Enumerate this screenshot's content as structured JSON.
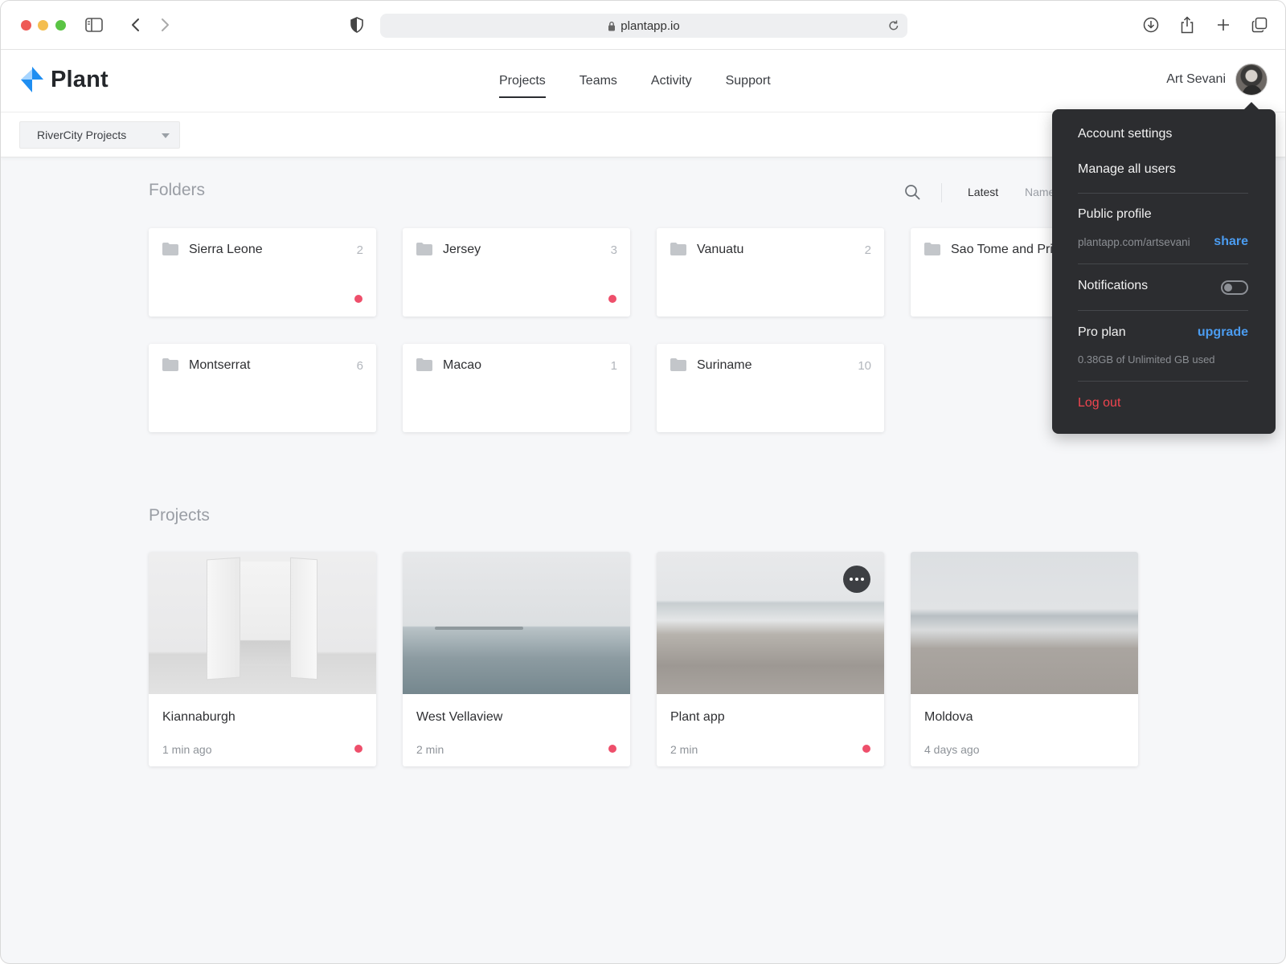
{
  "browser": {
    "url": "plantapp.io"
  },
  "app": {
    "logo_text": "Plant",
    "nav": [
      {
        "label": "Projects",
        "active": true
      },
      {
        "label": "Teams",
        "active": false
      },
      {
        "label": "Activity",
        "active": false
      },
      {
        "label": "Support",
        "active": false
      }
    ],
    "user_name": "Art Sevani",
    "team_selector": "RiverCity Projects"
  },
  "folders": {
    "title": "Folders",
    "sort": {
      "latest": "Latest",
      "name": "Name"
    },
    "items": [
      {
        "name": "Sierra Leone",
        "count": "2",
        "unread": true
      },
      {
        "name": "Jersey",
        "count": "3",
        "unread": true
      },
      {
        "name": "Vanuatu",
        "count": "2",
        "unread": false
      },
      {
        "name": "Sao Tome and Principe",
        "count": "",
        "unread": false
      },
      {
        "name": "Montserrat",
        "count": "6",
        "unread": false
      },
      {
        "name": "Macao",
        "count": "1",
        "unread": false
      },
      {
        "name": "Suriname",
        "count": "10",
        "unread": false
      }
    ]
  },
  "projects": {
    "title": "Projects",
    "items": [
      {
        "name": "Kiannaburgh",
        "time": "1 min ago",
        "unread": true,
        "thumb": "doors"
      },
      {
        "name": "West Vellaview",
        "time": "2 min",
        "unread": true,
        "thumb": "sea"
      },
      {
        "name": "Plant app",
        "time": "2 min",
        "unread": true,
        "thumb": "beach"
      },
      {
        "name": "Moldova",
        "time": "4 days ago",
        "unread": false,
        "thumb": "sand"
      }
    ]
  },
  "account_menu": {
    "account_settings": "Account settings",
    "manage_users": "Manage all users",
    "public_profile": "Public profile",
    "profile_url": "plantapp.com/artsevani",
    "share": "share",
    "notifications": "Notifications",
    "notifications_on": false,
    "plan": "Pro plan",
    "upgrade": "upgrade",
    "usage": "0.38GB of Unlimited GB used",
    "logout": "Log out"
  },
  "colors": {
    "accent_blue": "#4b9cf0",
    "logo_blue": "#1f8ef1",
    "unread_dot": "#ee4f6b",
    "logout_red": "#f0454f"
  }
}
